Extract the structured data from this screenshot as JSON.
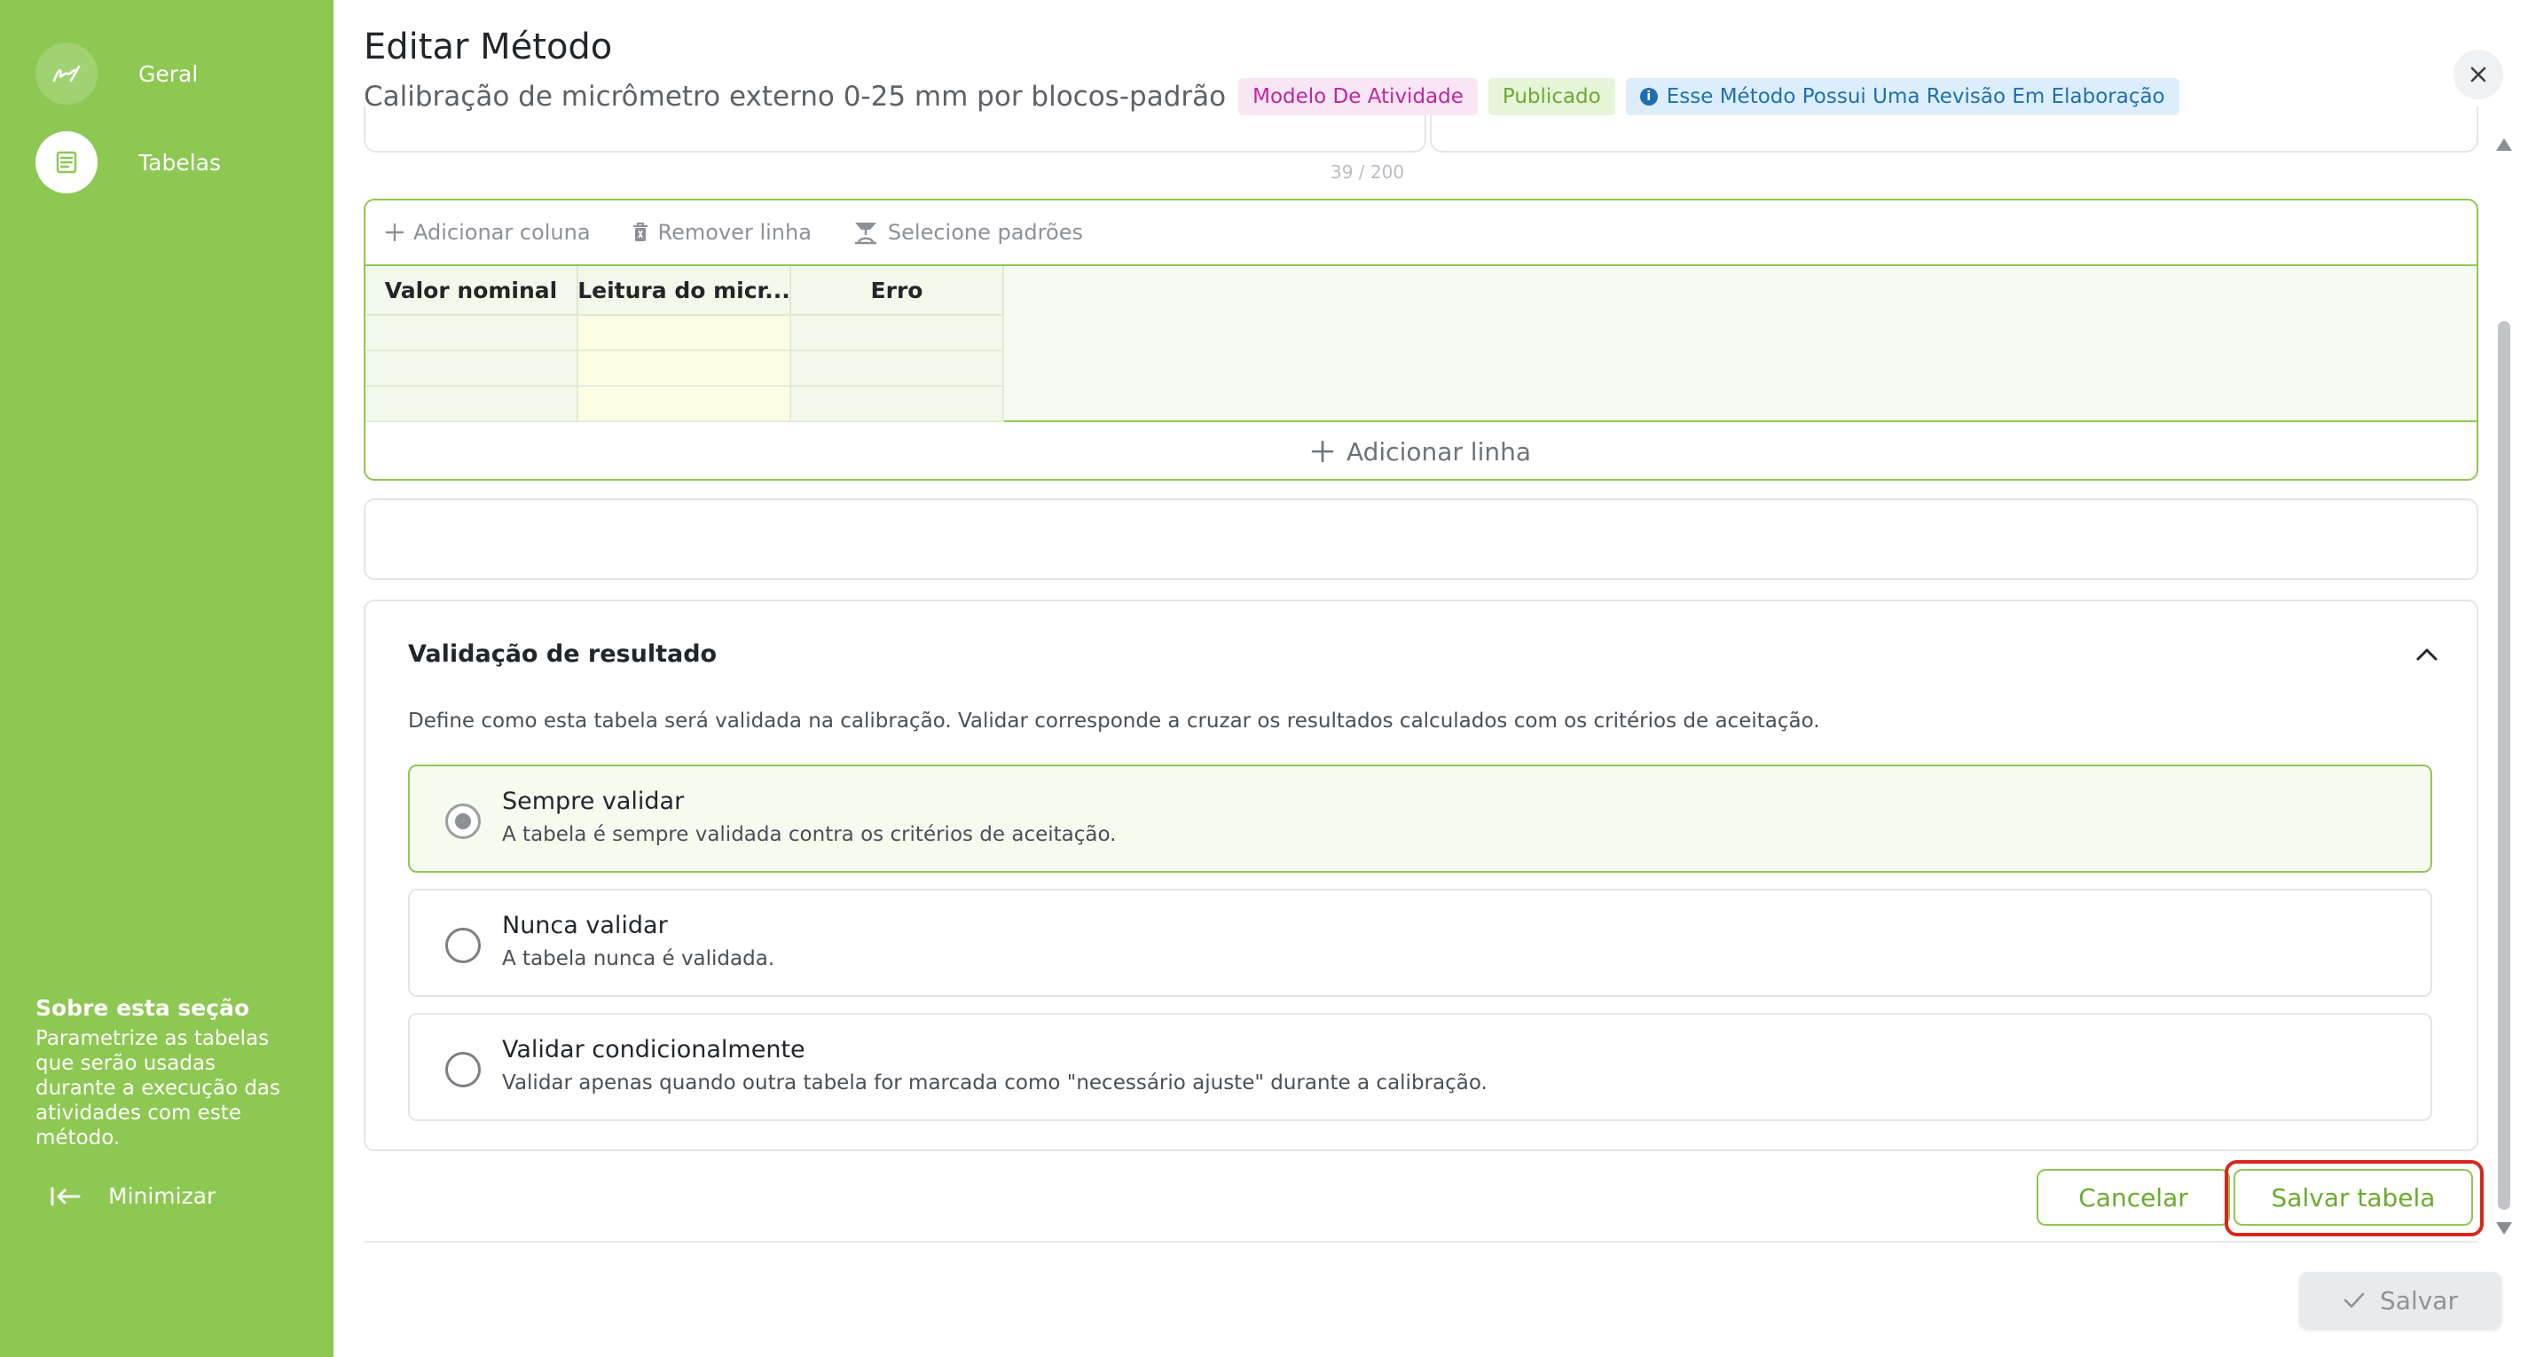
{
  "sidebar": {
    "items": [
      {
        "label": "Geral",
        "icon": "signature-icon"
      },
      {
        "label": "Tabelas",
        "icon": "table-icon"
      }
    ],
    "about_title": "Sobre esta seção",
    "about_text": "Parametrize as tabelas que serão usadas durante a execução das atividades com este método.",
    "minimize_label": "Minimizar"
  },
  "header": {
    "title": "Editar Método",
    "subtitle": "Calibração de micrômetro externo 0-25 mm por blocos-padrão",
    "badges": {
      "model": "Modelo De Atividade",
      "published": "Publicado",
      "revision": "Esse Método Possui Uma Revisão Em Elaboração"
    }
  },
  "counter": "39 / 200",
  "table_editor": {
    "toolbar": {
      "add_column": "Adicionar coluna",
      "remove_row": "Remover linha",
      "select_standards": "Selecione padrões"
    },
    "columns": [
      "Valor nominal",
      "Leitura do micr...",
      "Erro"
    ],
    "add_row": "Adicionar linha"
  },
  "validation": {
    "title": "Validação de resultado",
    "description": "Define como esta tabela será validada na calibração. Validar corresponde a cruzar os resultados calculados com os critérios de aceitação.",
    "options": [
      {
        "title": "Sempre validar",
        "description": "A tabela é sempre validada contra os critérios de aceitação.",
        "selected": true
      },
      {
        "title": "Nunca validar",
        "description": "A tabela nunca é validada.",
        "selected": false
      },
      {
        "title": "Validar condicionalmente",
        "description": "Validar apenas quando outra tabela for marcada como \"necessário ajuste\" durante a calibração.",
        "selected": false
      }
    ]
  },
  "footer": {
    "cancel": "Cancelar",
    "save_table": "Salvar tabela",
    "save": "Salvar"
  },
  "colors": {
    "sidebar": "#8dc852",
    "accent": "#6aac2e",
    "highlight": "#d9261c"
  }
}
